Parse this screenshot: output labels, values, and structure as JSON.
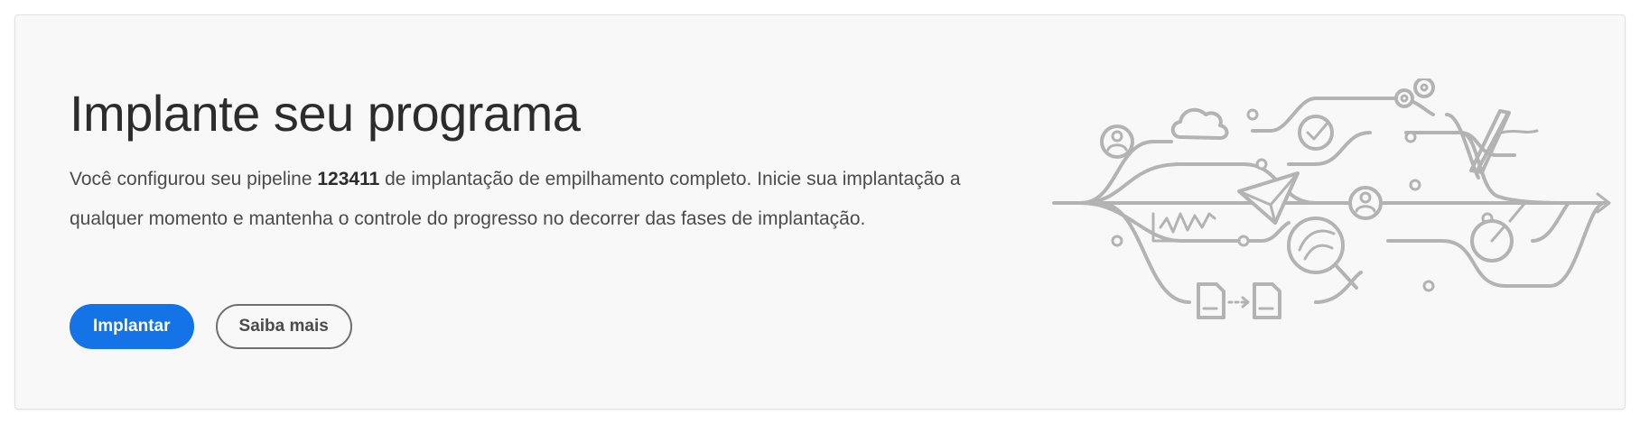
{
  "card": {
    "title": "Implante seu programa",
    "description_before": "Você configurou seu pipeline ",
    "pipeline_id": "123411",
    "description_after": " de implantação de empilhamento completo. Inicie sua implantação a qualquer momento e mantenha o controle do progresso no decorrer das fases de implantação."
  },
  "actions": {
    "primary_label": "Implantar",
    "secondary_label": "Saiba mais"
  },
  "colors": {
    "accent": "#1473e6",
    "illustration_stroke": "#b3b3b3",
    "card_background": "#f8f8f8"
  },
  "illustration": {
    "icons": [
      "user-icon",
      "cloud-icon",
      "check-icon",
      "gears-icon",
      "pen-icon",
      "paper-plane-icon",
      "chart-icon",
      "magnifier-icon",
      "gauge-icon",
      "document-icon",
      "arrow-right-icon"
    ]
  }
}
